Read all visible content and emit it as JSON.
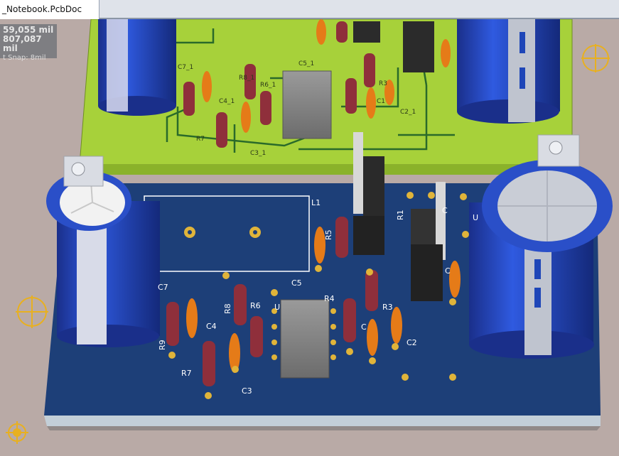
{
  "window": {
    "document_tab": "_Notebook.PcbDoc"
  },
  "readout": {
    "x": "59,055",
    "y": "807,087",
    "unit": "mil",
    "snap": "t Snap: 8mil"
  },
  "colors": {
    "top_board": "#a7d13a",
    "bottom_board": "#1d3f78",
    "board_edge": "#c3cfd8",
    "background": "#b9aaa6",
    "capacitor_blue": "#1e46b8",
    "pad_gold": "#e0b43a",
    "origin_marker": "#e8b020"
  },
  "icons": [
    "origin-crosshair-icon",
    "snap-target-icon"
  ],
  "silkscreen_bottom": {
    "L1": "L1",
    "C7": "C7",
    "C4": "C4",
    "C5": "C5",
    "R4": "R4",
    "R8": "R8",
    "R6": "R6",
    "U": "U",
    "R9": "R9",
    "R7": "R7",
    "C3": "C3",
    "R3": "R3",
    "C2": "C2",
    "R5": "R5",
    "R1": "R1",
    "C": "C",
    "Cb": "C",
    "Ud": "U",
    "Cd": "C"
  },
  "silkscreen_top": {
    "C7_1": "C7_1",
    "C4_1": "C4_1",
    "C5_1": "C5_1",
    "R6_1": "R6_1",
    "R8_1": "R8_1",
    "R7": "R7",
    "C3_1": "C3_1",
    "C2_1": "C2_1",
    "C1": "C1",
    "R3": "R3"
  }
}
